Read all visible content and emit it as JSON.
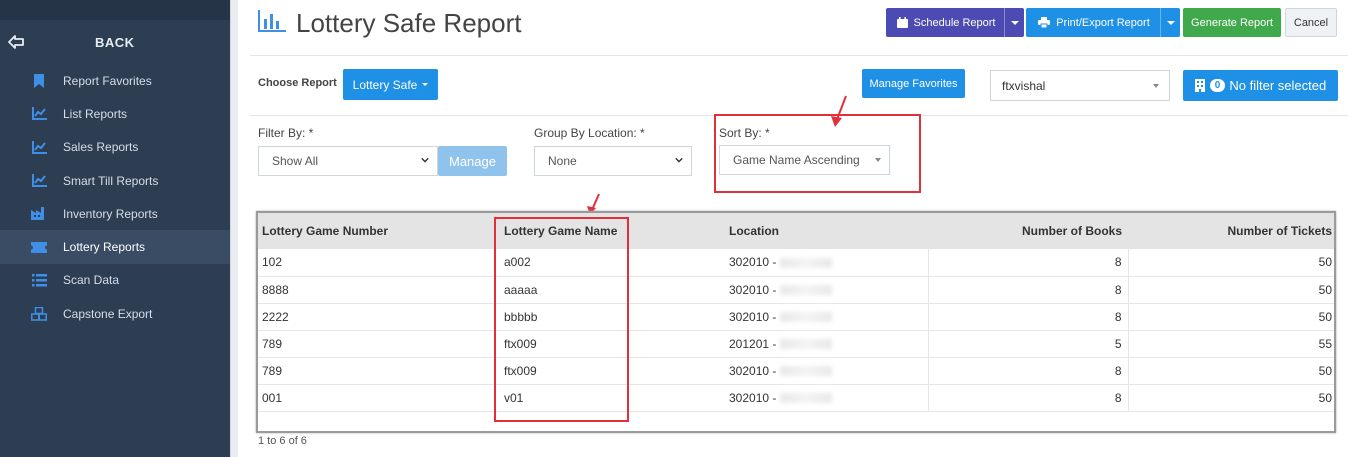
{
  "sidebar": {
    "back_label": "BACK",
    "items": [
      {
        "label": "Report Favorites",
        "icon": "bookmark-icon"
      },
      {
        "label": "List Reports",
        "icon": "line-chart-icon"
      },
      {
        "label": "Sales Reports",
        "icon": "line-chart-icon"
      },
      {
        "label": "Smart Till Reports",
        "icon": "line-chart-icon"
      },
      {
        "label": "Inventory Reports",
        "icon": "factory-icon"
      },
      {
        "label": "Lottery Reports",
        "icon": "ticket-icon",
        "active": true
      },
      {
        "label": "Scan Data",
        "icon": "list-icon"
      },
      {
        "label": "Capstone Export",
        "icon": "boxes-icon"
      }
    ]
  },
  "header": {
    "title": "Lottery Safe Report",
    "schedule_label": "Schedule Report",
    "print_label": "Print/Export Report",
    "generate_label": "Generate Report",
    "cancel_label": "Cancel"
  },
  "toolbar": {
    "choose_label": "Choose Report",
    "report_value": "Lottery Safe",
    "manage_favorites_label": "Manage Favorites",
    "user_value": "ftxvishal",
    "filter_count": "0",
    "filter_label": "No filter selected"
  },
  "filters": {
    "filter_by_label": "Filter By: *",
    "filter_by_value": "Show All",
    "manage_label": "Manage",
    "group_by_label": "Group By Location: *",
    "group_by_value": "None",
    "sort_by_label": "Sort By: *",
    "sort_by_value": "Game Name Ascending"
  },
  "table": {
    "columns": [
      "Lottery Game Number",
      "Lottery Game Name",
      "Location",
      "Number of Books",
      "Number of Tickets"
    ],
    "rows": [
      [
        "102",
        "a002",
        "302010 -",
        "8",
        "50"
      ],
      [
        "8888",
        "aaaaa",
        "302010 -",
        "8",
        "50"
      ],
      [
        "2222",
        "bbbbb",
        "302010 -",
        "8",
        "50"
      ],
      [
        "789",
        "ftx009",
        "201201 -",
        "5",
        "55"
      ],
      [
        "789",
        "ftx009",
        "302010 -",
        "8",
        "50"
      ],
      [
        "001",
        "v01",
        "302010 -",
        "8",
        "50"
      ]
    ]
  },
  "pager": "1 to 6 of 6",
  "colors": {
    "sidebar_bg": "#2d3d52",
    "primary": "#1e90e6",
    "schedule": "#4c4bb3",
    "generate": "#40a94c",
    "highlight": "#e2303a"
  }
}
